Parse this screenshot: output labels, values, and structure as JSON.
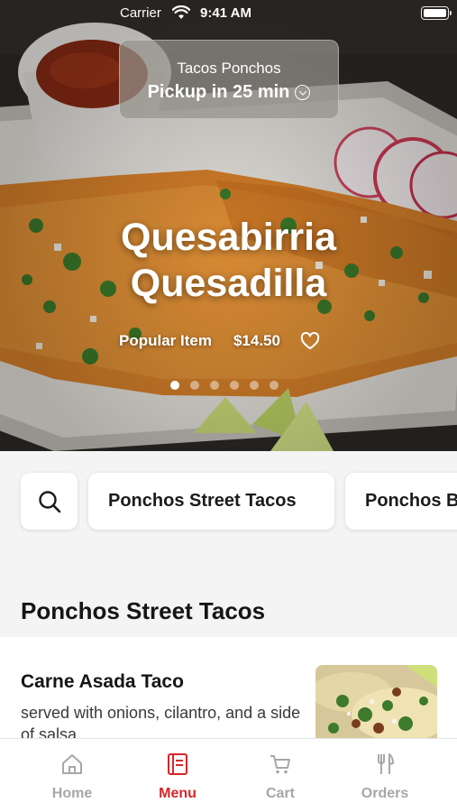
{
  "status_bar": {
    "carrier": "Carrier",
    "time": "9:41 AM"
  },
  "pickup": {
    "store_name": "Tacos Ponchos",
    "pickup_text": "Pickup in 25 min"
  },
  "featured_item": {
    "title_line1": "Quesabirria",
    "title_line2": "Quesadilla",
    "tag": "Popular Item",
    "price": "$14.50",
    "carousel_total": 6,
    "carousel_active_index": 0
  },
  "categories": {
    "search_icon": "search-icon",
    "items": [
      "Ponchos Street Tacos",
      "Ponchos Burritos"
    ]
  },
  "section": {
    "title": "Ponchos Street Tacos"
  },
  "menu_items": [
    {
      "name": "Carne Asada Taco",
      "description": "served with onions, cilantro, and a side of salsa"
    }
  ],
  "tab_bar": {
    "tabs": [
      {
        "label": "Home",
        "icon": "home-icon"
      },
      {
        "label": "Menu",
        "icon": "menu-icon"
      },
      {
        "label": "Cart",
        "icon": "cart-icon"
      },
      {
        "label": "Orders",
        "icon": "fork-knife-icon"
      }
    ],
    "active_tab": "Menu"
  },
  "colors": {
    "accent": "#d7262a",
    "inactive_tab": "#a7a7a7",
    "text": "#151515"
  }
}
